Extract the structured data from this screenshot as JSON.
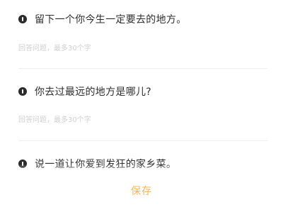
{
  "questions": [
    {
      "text": "留下一个你今生一定要去的地方。",
      "answer_placeholder": "回答问题，最多30个字",
      "answer_value": ""
    },
    {
      "text": "你去过最远的地方是哪儿?",
      "answer_placeholder": "回答问题，最多30个字",
      "answer_value": ""
    },
    {
      "text": "说一道让你爱到发狂的家乡菜。",
      "answer_placeholder": "",
      "answer_value": ""
    }
  ],
  "footer": {
    "save_label": "保存"
  },
  "colors": {
    "accent": "#f2b55a",
    "question_text": "#2e2e2e",
    "placeholder": "#cfcfcf",
    "divider": "#eeeeee"
  },
  "icons": {
    "question_marker": "exclamation-badge-icon"
  }
}
